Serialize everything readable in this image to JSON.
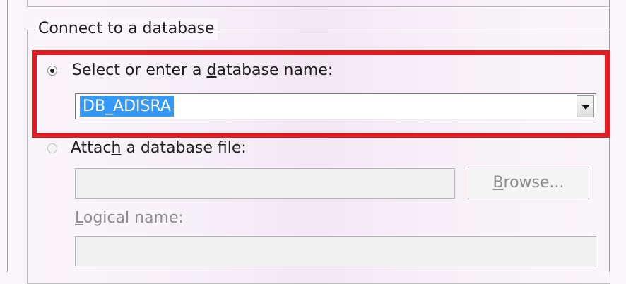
{
  "group": {
    "legend": "Connect to a database"
  },
  "option_select": {
    "label_before": "Select or enter a ",
    "label_accel": "d",
    "label_after": "atabase name:",
    "selected": true
  },
  "database_combo": {
    "value": "DB_ADISRA",
    "dropdown_icon": "chevron-down-icon"
  },
  "option_attach": {
    "label_before": "Attac",
    "label_accel": "h",
    "label_after": " a database file:",
    "selected": false
  },
  "attach_file_input": {
    "value": ""
  },
  "browse_button": {
    "label_accel": "B",
    "label_after": "rowse..."
  },
  "logical_name": {
    "label_accel": "L",
    "label_after": "ogical name:",
    "value": ""
  },
  "colors": {
    "highlight_border": "#e31b23",
    "selection_background": "#3399ff",
    "selection_text": "#ffffff",
    "disabled_text": "#8c8c8c"
  }
}
